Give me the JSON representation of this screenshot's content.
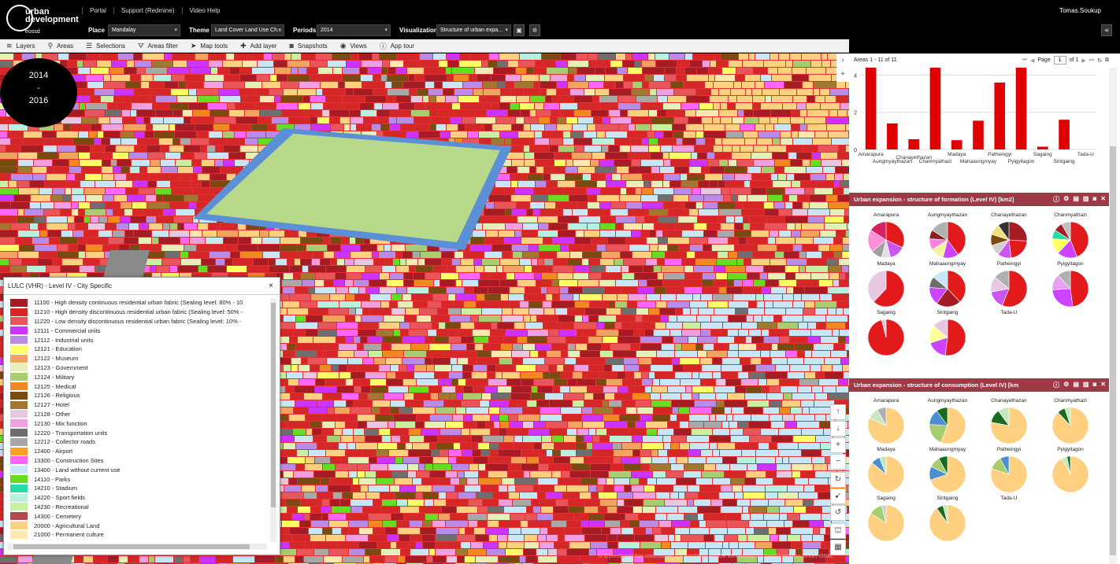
{
  "header": {
    "logo_line1": "urban",
    "logo_line2": "development",
    "logo_sub": "eossd",
    "links": [
      "Portal",
      "Support (Redmine)",
      "Video Help"
    ],
    "user": "Tomas.Soukup",
    "place_label": "Place",
    "place_value": "Mandalay",
    "theme_label": "Theme",
    "theme_value": "Land Cover Land Use Ch...",
    "periods_label": "Periods",
    "periods_value": "2014",
    "visualization_label": "Visualization",
    "visualization_value": "Structure of urban expa..."
  },
  "toolbar": [
    {
      "icon": "layers-icon",
      "glyph": "≋",
      "label": "Layers"
    },
    {
      "icon": "pin-icon",
      "glyph": "⚲",
      "label": "Areas"
    },
    {
      "icon": "list-icon",
      "glyph": "☰",
      "label": "Selections"
    },
    {
      "icon": "filter-icon",
      "glyph": "⛛",
      "label": "Areas filter"
    },
    {
      "icon": "cursor-icon",
      "glyph": "➤",
      "label": "Map tools"
    },
    {
      "icon": "add-layer-icon",
      "glyph": "✚",
      "label": "Add layer"
    },
    {
      "icon": "camera-icon",
      "glyph": "◙",
      "label": "Snapshots"
    },
    {
      "icon": "eye-icon",
      "glyph": "◉",
      "label": "Views"
    },
    {
      "icon": "info-icon",
      "glyph": "ⓘ",
      "label": "App tour"
    }
  ],
  "map": {
    "period_from": "2014",
    "period_sep": "-",
    "period_to": "2016",
    "attribution": "© OpenStreetMap contributors © CartoDB, CartoDB attributions © OpenStreetMap, under ODbL"
  },
  "legend": {
    "title": "LULC (VHR) - Level IV - City Specific",
    "close": "×",
    "items": [
      {
        "color": "#a51c24",
        "label": "11100 - High density continuous residential urban fabric (Sealing level: 80% - 10"
      },
      {
        "color": "#d62728",
        "label": "11210 - High density discontinuous residential urban fabric (Sealing level: 50% -"
      },
      {
        "color": "#e8555a",
        "label": "11220 - Low density discontinuous residential urban fabric (Sealing level: 10% -"
      },
      {
        "color": "#cc33ff",
        "label": "12111 - Commercial units"
      },
      {
        "color": "#b98ae6",
        "label": "12112 - Industrial units"
      },
      {
        "color": "#ffff66",
        "label": "12121 - Education"
      },
      {
        "color": "#f0a460",
        "label": "12122 - Museum"
      },
      {
        "color": "#e5f0b8",
        "label": "12123 - Government"
      },
      {
        "color": "#a8cc70",
        "label": "12124 - Military"
      },
      {
        "color": "#f08a20",
        "label": "12125 - Medical"
      },
      {
        "color": "#7a4a10",
        "label": "12126 - Religious"
      },
      {
        "color": "#a07830",
        "label": "12127 - Hotel"
      },
      {
        "color": "#e8c8e0",
        "label": "12128 - Other"
      },
      {
        "color": "#f0a0e0",
        "label": "12130 - Mix function"
      },
      {
        "color": "#6e6e6e",
        "label": "12220 - Transportation units"
      },
      {
        "color": "#a8a8a8",
        "label": "12212 - Collector roads"
      },
      {
        "color": "#ffa020",
        "label": "12400 - Airport"
      },
      {
        "color": "#ff66ff",
        "label": "13300 - Construction Sites"
      },
      {
        "color": "#c8e6f6",
        "label": "13400 - Land without current use"
      },
      {
        "color": "#66dd22",
        "label": "14110 - Parks"
      },
      {
        "color": "#22ddaa",
        "label": "14210 - Stadium"
      },
      {
        "color": "#b8f0e0",
        "label": "14220 - Sport fields"
      },
      {
        "color": "#c8f0a0",
        "label": "14230 - Recreational"
      },
      {
        "color": "#b04a50",
        "label": "14300 - Cemetery"
      },
      {
        "color": "#ffd080",
        "label": "20000 - Agricultural Land"
      },
      {
        "color": "#ffe8b0",
        "label": "21000 - Permanent culture"
      }
    ]
  },
  "panel": {
    "areas_label": "Areas 1 - 11 of 11",
    "page_label": "Page",
    "page_value": "1",
    "of_label": "of 1"
  },
  "chart_data": [
    {
      "type": "bar",
      "categories": [
        "Amarapura",
        "Aungmyaythazan",
        "Chanayethazan",
        "Chanmyathazi",
        "Madaya",
        "Mahaaungmyay",
        "Patheingyi",
        "Pyigyitagon",
        "Sagaing",
        "Sintgaing",
        "Tada-U"
      ],
      "values": [
        4.4,
        1.4,
        0.55,
        4.4,
        0.5,
        1.55,
        3.6,
        4.4,
        0.15,
        1.6,
        0.0
      ],
      "ylim": [
        0,
        4.4
      ],
      "yticks": [
        "0",
        "2",
        "4"
      ],
      "color": "#e10000",
      "grid": true
    },
    {
      "type": "pie",
      "title": "Urban expansion - structure of formation (Level IV) [km2]",
      "charts": [
        {
          "name": "Amarapura",
          "slices": [
            {
              "v": 32,
              "c": "#e31a1c"
            },
            {
              "v": 14,
              "c": "#cc55ee"
            },
            {
              "v": 8,
              "c": "#e0e0e0"
            },
            {
              "v": 10,
              "c": "#a0a0a0"
            },
            {
              "v": 20,
              "c": "#ff8fd8"
            },
            {
              "v": 16,
              "c": "#d62060"
            }
          ]
        },
        {
          "name": "Aungmyaythazan",
          "slices": [
            {
              "v": 40,
              "c": "#e31a1c"
            },
            {
              "v": 14,
              "c": "#cc44ff"
            },
            {
              "v": 12,
              "c": "#f5f5a0"
            },
            {
              "v": 10,
              "c": "#ff80e0"
            },
            {
              "v": 8,
              "c": "#8a2020"
            },
            {
              "v": 16,
              "c": "#b0b0b0"
            }
          ]
        },
        {
          "name": "Chanayethazan",
          "slices": [
            {
              "v": 26,
              "c": "#a51c24"
            },
            {
              "v": 22,
              "c": "#e31a1c"
            },
            {
              "v": 12,
              "c": "#cc55ee"
            },
            {
              "v": 10,
              "c": "#d0d0d0"
            },
            {
              "v": 10,
              "c": "#7a4a10"
            },
            {
              "v": 10,
              "c": "#f0e080"
            },
            {
              "v": 10,
              "c": "#333"
            }
          ]
        },
        {
          "name": "Chanmyathazi",
          "slices": [
            {
              "v": 44,
              "c": "#e31a1c"
            },
            {
              "v": 18,
              "c": "#cc44ff"
            },
            {
              "v": 14,
              "c": "#ffff66"
            },
            {
              "v": 8,
              "c": "#22ddaa"
            },
            {
              "v": 8,
              "c": "#a51c24"
            },
            {
              "v": 8,
              "c": "#c0c0c0"
            }
          ]
        },
        {
          "name": "Madaya",
          "slices": [
            {
              "v": 62,
              "c": "#e31a1c"
            },
            {
              "v": 38,
              "c": "#e8c8e0"
            }
          ]
        },
        {
          "name": "Mahaaungmyay",
          "slices": [
            {
              "v": 38,
              "c": "#e31a1c"
            },
            {
              "v": 22,
              "c": "#a51c24"
            },
            {
              "v": 16,
              "c": "#cc44ff"
            },
            {
              "v": 10,
              "c": "#6e6e6e"
            },
            {
              "v": 14,
              "c": "#c8e6f6"
            }
          ]
        },
        {
          "name": "Patheingyi",
          "slices": [
            {
              "v": 56,
              "c": "#e31a1c"
            },
            {
              "v": 16,
              "c": "#cc55ee"
            },
            {
              "v": 14,
              "c": "#e8c8e0"
            },
            {
              "v": 14,
              "c": "#b0b0b0"
            }
          ]
        },
        {
          "name": "Pyigyitagon",
          "slices": [
            {
              "v": 48,
              "c": "#e31a1c"
            },
            {
              "v": 26,
              "c": "#cc44ff"
            },
            {
              "v": 14,
              "c": "#e8a0f0"
            },
            {
              "v": 12,
              "c": "#b0b0b0"
            }
          ]
        },
        {
          "name": "Sagaing",
          "slices": [
            {
              "v": 96,
              "c": "#e31a1c"
            },
            {
              "v": 4,
              "c": "#e8c8e0"
            }
          ]
        },
        {
          "name": "Sintgaing",
          "slices": [
            {
              "v": 52,
              "c": "#e31a1c"
            },
            {
              "v": 18,
              "c": "#cc44ff"
            },
            {
              "v": 16,
              "c": "#ffff99"
            },
            {
              "v": 14,
              "c": "#e8c8e0"
            }
          ]
        },
        {
          "name": "Tada-U",
          "slices": []
        }
      ]
    },
    {
      "type": "pie",
      "title": "Urban expansion - structure of consumption (Level IV) [km",
      "charts": [
        {
          "name": "Amarapura",
          "slices": [
            {
              "v": 82,
              "c": "#ffd080"
            },
            {
              "v": 10,
              "c": "#c8e6c0"
            },
            {
              "v": 8,
              "c": "#b0b0b0"
            }
          ]
        },
        {
          "name": "Aungmyaythazan",
          "slices": [
            {
              "v": 56,
              "c": "#ffd080"
            },
            {
              "v": 20,
              "c": "#a8cc70"
            },
            {
              "v": 14,
              "c": "#4a90d0"
            },
            {
              "v": 10,
              "c": "#1a6a20"
            }
          ]
        },
        {
          "name": "Chanayethazan",
          "slices": [
            {
              "v": 78,
              "c": "#ffd080"
            },
            {
              "v": 12,
              "c": "#1a6a20"
            },
            {
              "v": 10,
              "c": "#c8e6c0"
            }
          ]
        },
        {
          "name": "Chanmyathazi",
          "slices": [
            {
              "v": 88,
              "c": "#ffd080"
            },
            {
              "v": 7,
              "c": "#1a6a20"
            },
            {
              "v": 5,
              "c": "#c8e6c0"
            }
          ]
        },
        {
          "name": "Madaya",
          "slices": [
            {
              "v": 86,
              "c": "#ffd080"
            },
            {
              "v": 8,
              "c": "#4a90d0"
            },
            {
              "v": 6,
              "c": "#c8e6c0"
            }
          ]
        },
        {
          "name": "Mahaaungmyay",
          "slices": [
            {
              "v": 70,
              "c": "#ffd080"
            },
            {
              "v": 12,
              "c": "#4a90d0"
            },
            {
              "v": 10,
              "c": "#a8cc70"
            },
            {
              "v": 8,
              "c": "#1a6a20"
            }
          ]
        },
        {
          "name": "Patheingyi",
          "slices": [
            {
              "v": 80,
              "c": "#ffd080"
            },
            {
              "v": 12,
              "c": "#a8cc70"
            },
            {
              "v": 8,
              "c": "#4a90d0"
            }
          ]
        },
        {
          "name": "Pyigyitagon",
          "slices": [
            {
              "v": 92,
              "c": "#ffd080"
            },
            {
              "v": 5,
              "c": "#c8e6c0"
            },
            {
              "v": 3,
              "c": "#1a6a20"
            }
          ]
        },
        {
          "name": "Sagaing",
          "slices": [
            {
              "v": 84,
              "c": "#ffd080"
            },
            {
              "v": 12,
              "c": "#a8cc70"
            },
            {
              "v": 4,
              "c": "#d0d0d0"
            }
          ]
        },
        {
          "name": "Sintgaing",
          "slices": [
            {
              "v": 90,
              "c": "#ffd080"
            },
            {
              "v": 6,
              "c": "#1a6a20"
            },
            {
              "v": 4,
              "c": "#c8e6c0"
            }
          ]
        },
        {
          "name": "Tada-U",
          "slices": []
        }
      ]
    }
  ]
}
